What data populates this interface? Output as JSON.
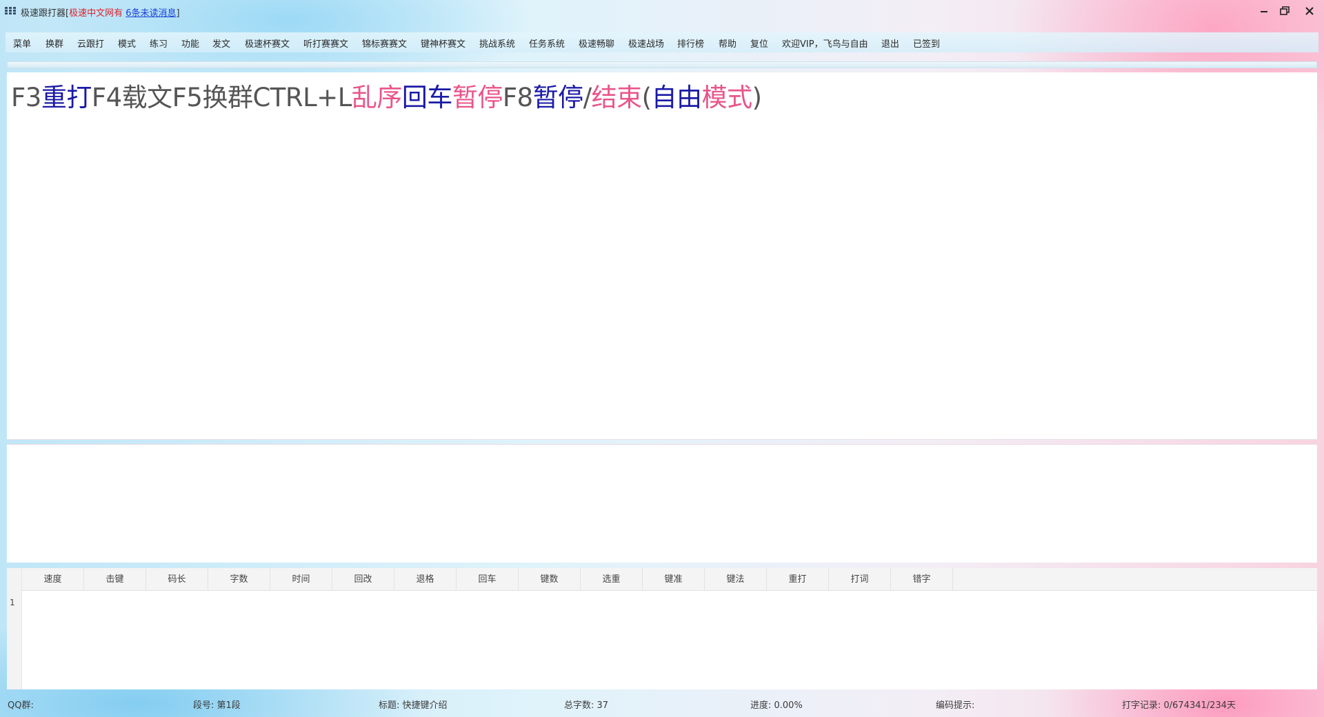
{
  "window": {
    "title_prefix": "极速跟打器[",
    "title_site": "极速中文网有",
    "title_link": "6条未读消息",
    "title_suffix": "]"
  },
  "menu": [
    "菜单",
    "换群",
    "云跟打",
    "模式",
    "练习",
    "功能",
    "发文",
    "极速杯赛文",
    "听打赛赛文",
    "锦标赛赛文",
    "键神杯赛文",
    "挑战系统",
    "任务系统",
    "极速畅聊",
    "极速战场",
    "排行榜",
    "帮助",
    "复位",
    "欢迎VIP，飞鸟与自由",
    "退出",
    "已签到"
  ],
  "headline": [
    {
      "text": "F3",
      "color": "gray"
    },
    {
      "text": "重打",
      "color": "blue"
    },
    {
      "text": "F4载文F5换群CTRL+L",
      "color": "gray"
    },
    {
      "text": "乱序",
      "color": "pink"
    },
    {
      "text": "回车",
      "color": "blue"
    },
    {
      "text": "暂停",
      "color": "pink"
    },
    {
      "text": "F8",
      "color": "gray"
    },
    {
      "text": "暂停",
      "color": "blue"
    },
    {
      "text": "/",
      "color": "gray"
    },
    {
      "text": "结束",
      "color": "pink"
    },
    {
      "text": "(",
      "color": "gray"
    },
    {
      "text": "自由",
      "color": "blue"
    },
    {
      "text": "模式",
      "color": "pink"
    },
    {
      "text": ")",
      "color": "gray"
    }
  ],
  "table": {
    "columns": [
      "速度",
      "击键",
      "码长",
      "字数",
      "时间",
      "回改",
      "退格",
      "回车",
      "键数",
      "选重",
      "键准",
      "键法",
      "重打",
      "打词",
      "错字"
    ],
    "row_numbers": [
      "1"
    ]
  },
  "status": {
    "qq": "QQ群:",
    "segment": "段号: 第1段",
    "title": "标题: 快捷键介绍",
    "total": "总字数: 37",
    "progress": "进度: 0.00%",
    "hint": "编码提示:",
    "record": "打字记录: 0/674341/234天"
  },
  "colors": {
    "gray": "#555555",
    "blue": "#1a1aa6",
    "pink": "#e8558a",
    "title_red": "#e0212a",
    "title_link": "#1a3fd6"
  },
  "icons": [
    "app-menu-icon",
    "minimize-icon",
    "restore-icon",
    "close-icon"
  ]
}
